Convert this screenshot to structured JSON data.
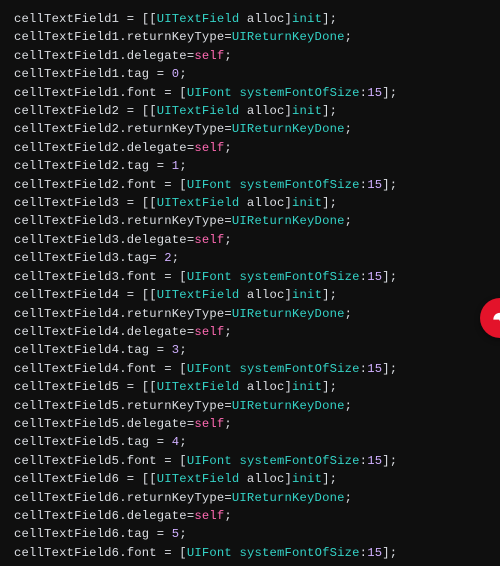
{
  "code": {
    "lines": [
      [
        {
          "t": "cellTextField1 = [[",
          "c": "plain"
        },
        {
          "t": "UITextField",
          "c": "kw"
        },
        {
          "t": " alloc]",
          "c": "plain"
        },
        {
          "t": "init",
          "c": "kw"
        },
        {
          "t": "];",
          "c": "plain"
        }
      ],
      [
        {
          "t": "cellTextField1.returnKeyType=",
          "c": "plain"
        },
        {
          "t": "UIReturnKeyDone",
          "c": "kw"
        },
        {
          "t": ";",
          "c": "plain"
        }
      ],
      [
        {
          "t": "cellTextField1.delegate=",
          "c": "plain"
        },
        {
          "t": "self",
          "c": "self"
        },
        {
          "t": ";",
          "c": "plain"
        }
      ],
      [
        {
          "t": "cellTextField1.tag = ",
          "c": "plain"
        },
        {
          "t": "0",
          "c": "num"
        },
        {
          "t": ";",
          "c": "plain"
        }
      ],
      [
        {
          "t": "cellTextField1.font = [",
          "c": "plain"
        },
        {
          "t": "UIFont",
          "c": "kw"
        },
        {
          "t": " ",
          "c": "plain"
        },
        {
          "t": "systemFontOfSize",
          "c": "kw"
        },
        {
          "t": ":",
          "c": "plain"
        },
        {
          "t": "15",
          "c": "num"
        },
        {
          "t": "];",
          "c": "plain"
        }
      ],
      [
        {
          "t": "cellTextField2 = [[",
          "c": "plain"
        },
        {
          "t": "UITextField",
          "c": "kw"
        },
        {
          "t": " alloc]",
          "c": "plain"
        },
        {
          "t": "init",
          "c": "kw"
        },
        {
          "t": "];",
          "c": "plain"
        }
      ],
      [
        {
          "t": "cellTextField2.returnKeyType=",
          "c": "plain"
        },
        {
          "t": "UIReturnKeyDone",
          "c": "kw"
        },
        {
          "t": ";",
          "c": "plain"
        }
      ],
      [
        {
          "t": "cellTextField2.delegate=",
          "c": "plain"
        },
        {
          "t": "self",
          "c": "self"
        },
        {
          "t": ";",
          "c": "plain"
        }
      ],
      [
        {
          "t": "cellTextField2.tag = ",
          "c": "plain"
        },
        {
          "t": "1",
          "c": "num"
        },
        {
          "t": ";",
          "c": "plain"
        }
      ],
      [
        {
          "t": "cellTextField2.font = [",
          "c": "plain"
        },
        {
          "t": "UIFont",
          "c": "kw"
        },
        {
          "t": " ",
          "c": "plain"
        },
        {
          "t": "systemFontOfSize",
          "c": "kw"
        },
        {
          "t": ":",
          "c": "plain"
        },
        {
          "t": "15",
          "c": "num"
        },
        {
          "t": "];",
          "c": "plain"
        }
      ],
      [
        {
          "t": "cellTextField3 = [[",
          "c": "plain"
        },
        {
          "t": "UITextField",
          "c": "kw"
        },
        {
          "t": " alloc]",
          "c": "plain"
        },
        {
          "t": "init",
          "c": "kw"
        },
        {
          "t": "];",
          "c": "plain"
        }
      ],
      [
        {
          "t": "cellTextField3.returnKeyType=",
          "c": "plain"
        },
        {
          "t": "UIReturnKeyDone",
          "c": "kw"
        },
        {
          "t": ";",
          "c": "plain"
        }
      ],
      [
        {
          "t": "cellTextField3.delegate=",
          "c": "plain"
        },
        {
          "t": "self",
          "c": "self"
        },
        {
          "t": ";",
          "c": "plain"
        }
      ],
      [
        {
          "t": "cellTextField3.tag= ",
          "c": "plain"
        },
        {
          "t": "2",
          "c": "num"
        },
        {
          "t": ";",
          "c": "plain"
        }
      ],
      [
        {
          "t": "cellTextField3.font = [",
          "c": "plain"
        },
        {
          "t": "UIFont",
          "c": "kw"
        },
        {
          "t": " ",
          "c": "plain"
        },
        {
          "t": "systemFontOfSize",
          "c": "kw"
        },
        {
          "t": ":",
          "c": "plain"
        },
        {
          "t": "15",
          "c": "num"
        },
        {
          "t": "];",
          "c": "plain"
        }
      ],
      [
        {
          "t": "cellTextField4 = [[",
          "c": "plain"
        },
        {
          "t": "UITextField",
          "c": "kw"
        },
        {
          "t": " alloc]",
          "c": "plain"
        },
        {
          "t": "init",
          "c": "kw"
        },
        {
          "t": "];",
          "c": "plain"
        }
      ],
      [
        {
          "t": "cellTextField4.returnKeyType=",
          "c": "plain"
        },
        {
          "t": "UIReturnKeyDone",
          "c": "kw"
        },
        {
          "t": ";",
          "c": "plain"
        }
      ],
      [
        {
          "t": "cellTextField4.delegate=",
          "c": "plain"
        },
        {
          "t": "self",
          "c": "self"
        },
        {
          "t": ";",
          "c": "plain"
        }
      ],
      [
        {
          "t": "cellTextField4.tag = ",
          "c": "plain"
        },
        {
          "t": "3",
          "c": "num"
        },
        {
          "t": ";",
          "c": "plain"
        }
      ],
      [
        {
          "t": "cellTextField4.font = [",
          "c": "plain"
        },
        {
          "t": "UIFont",
          "c": "kw"
        },
        {
          "t": " ",
          "c": "plain"
        },
        {
          "t": "systemFontOfSize",
          "c": "kw"
        },
        {
          "t": ":",
          "c": "plain"
        },
        {
          "t": "15",
          "c": "num"
        },
        {
          "t": "];",
          "c": "plain"
        }
      ],
      [
        {
          "t": "cellTextField5 = [[",
          "c": "plain"
        },
        {
          "t": "UITextField",
          "c": "kw"
        },
        {
          "t": " alloc]",
          "c": "plain"
        },
        {
          "t": "init",
          "c": "kw"
        },
        {
          "t": "];",
          "c": "plain"
        }
      ],
      [
        {
          "t": "cellTextField5.returnKeyType=",
          "c": "plain"
        },
        {
          "t": "UIReturnKeyDone",
          "c": "kw"
        },
        {
          "t": ";",
          "c": "plain"
        }
      ],
      [
        {
          "t": "cellTextField5.delegate=",
          "c": "plain"
        },
        {
          "t": "self",
          "c": "self"
        },
        {
          "t": ";",
          "c": "plain"
        }
      ],
      [
        {
          "t": "cellTextField5.tag = ",
          "c": "plain"
        },
        {
          "t": "4",
          "c": "num"
        },
        {
          "t": ";",
          "c": "plain"
        }
      ],
      [
        {
          "t": "cellTextField5.font = [",
          "c": "plain"
        },
        {
          "t": "UIFont",
          "c": "kw"
        },
        {
          "t": " ",
          "c": "plain"
        },
        {
          "t": "systemFontOfSize",
          "c": "kw"
        },
        {
          "t": ":",
          "c": "plain"
        },
        {
          "t": "15",
          "c": "num"
        },
        {
          "t": "];",
          "c": "plain"
        }
      ],
      [
        {
          "t": "cellTextField6 = [[",
          "c": "plain"
        },
        {
          "t": "UITextField",
          "c": "kw"
        },
        {
          "t": " alloc]",
          "c": "plain"
        },
        {
          "t": "init",
          "c": "kw"
        },
        {
          "t": "];",
          "c": "plain"
        }
      ],
      [
        {
          "t": "cellTextField6.returnKeyType=",
          "c": "plain"
        },
        {
          "t": "UIReturnKeyDone",
          "c": "kw"
        },
        {
          "t": ";",
          "c": "plain"
        }
      ],
      [
        {
          "t": "cellTextField6.delegate=",
          "c": "plain"
        },
        {
          "t": "self",
          "c": "self"
        },
        {
          "t": ";",
          "c": "plain"
        }
      ],
      [
        {
          "t": "cellTextField6.tag = ",
          "c": "plain"
        },
        {
          "t": "5",
          "c": "num"
        },
        {
          "t": ";",
          "c": "plain"
        }
      ],
      [
        {
          "t": "cellTextField6.font = [",
          "c": "plain"
        },
        {
          "t": "UIFont",
          "c": "kw"
        },
        {
          "t": " ",
          "c": "plain"
        },
        {
          "t": "systemFontOfSize",
          "c": "kw"
        },
        {
          "t": ":",
          "c": "plain"
        },
        {
          "t": "15",
          "c": "num"
        },
        {
          "t": "];",
          "c": "plain"
        }
      ]
    ]
  },
  "badge": {
    "name": "bird-icon"
  }
}
